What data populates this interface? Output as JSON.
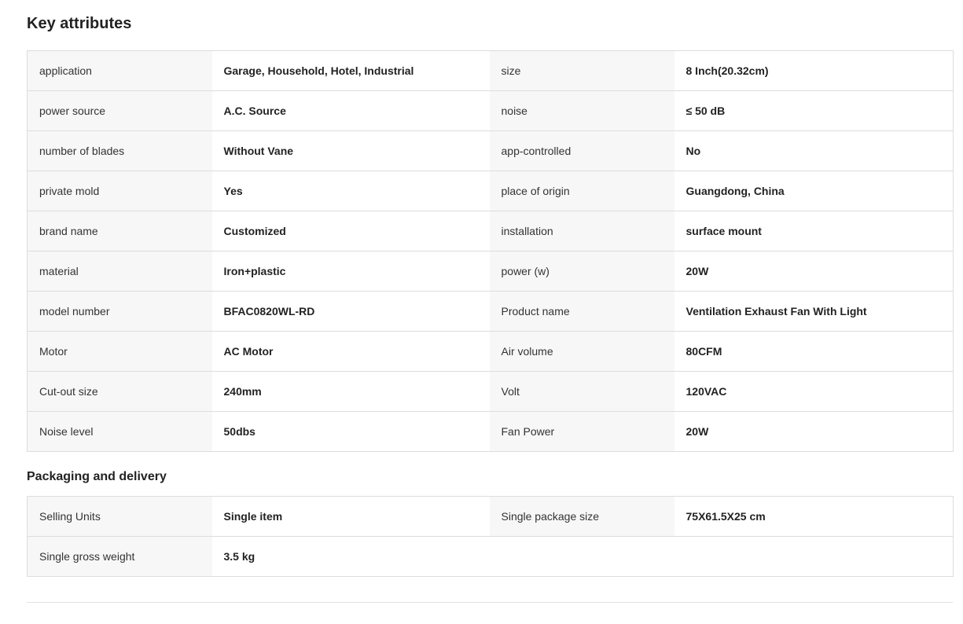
{
  "key_attributes": {
    "title": "Key attributes",
    "rows": [
      [
        {
          "name": "application",
          "value": "Garage, Household, Hotel, Industrial"
        },
        {
          "name": "size",
          "value": "8 Inch(20.32cm)"
        }
      ],
      [
        {
          "name": "power source",
          "value": "A.C. Source"
        },
        {
          "name": "noise",
          "value": "≤ 50 dB"
        }
      ],
      [
        {
          "name": "number of blades",
          "value": "Without Vane"
        },
        {
          "name": "app-controlled",
          "value": "No"
        }
      ],
      [
        {
          "name": "private mold",
          "value": "Yes"
        },
        {
          "name": "place of origin",
          "value": "Guangdong, China"
        }
      ],
      [
        {
          "name": "brand name",
          "value": "Customized"
        },
        {
          "name": "installation",
          "value": "surface mount"
        }
      ],
      [
        {
          "name": "material",
          "value": "Iron+plastic"
        },
        {
          "name": "power (w)",
          "value": "20W"
        }
      ],
      [
        {
          "name": "model number",
          "value": "BFAC0820WL-RD"
        },
        {
          "name": "Product name",
          "value": "Ventilation Exhaust Fan With Light"
        }
      ],
      [
        {
          "name": "Motor",
          "value": "AC Motor"
        },
        {
          "name": "Air volume",
          "value": "80CFM"
        }
      ],
      [
        {
          "name": "Cut-out size",
          "value": "240mm"
        },
        {
          "name": "Volt",
          "value": "120VAC"
        }
      ],
      [
        {
          "name": "Noise level",
          "value": "50dbs"
        },
        {
          "name": "Fan Power",
          "value": "20W"
        }
      ]
    ]
  },
  "packaging": {
    "title": "Packaging and delivery",
    "rows": [
      [
        {
          "name": "Selling Units",
          "value": "Single item"
        },
        {
          "name": "Single package size",
          "value": "75X61.5X25 cm"
        }
      ],
      [
        {
          "name": "Single gross weight",
          "value": "3.5 kg"
        },
        {
          "name": "",
          "value": ""
        }
      ]
    ]
  },
  "colors": {
    "name_cell_bg": "#f7f7f7",
    "border": "#dddddd",
    "text": "#222222"
  }
}
